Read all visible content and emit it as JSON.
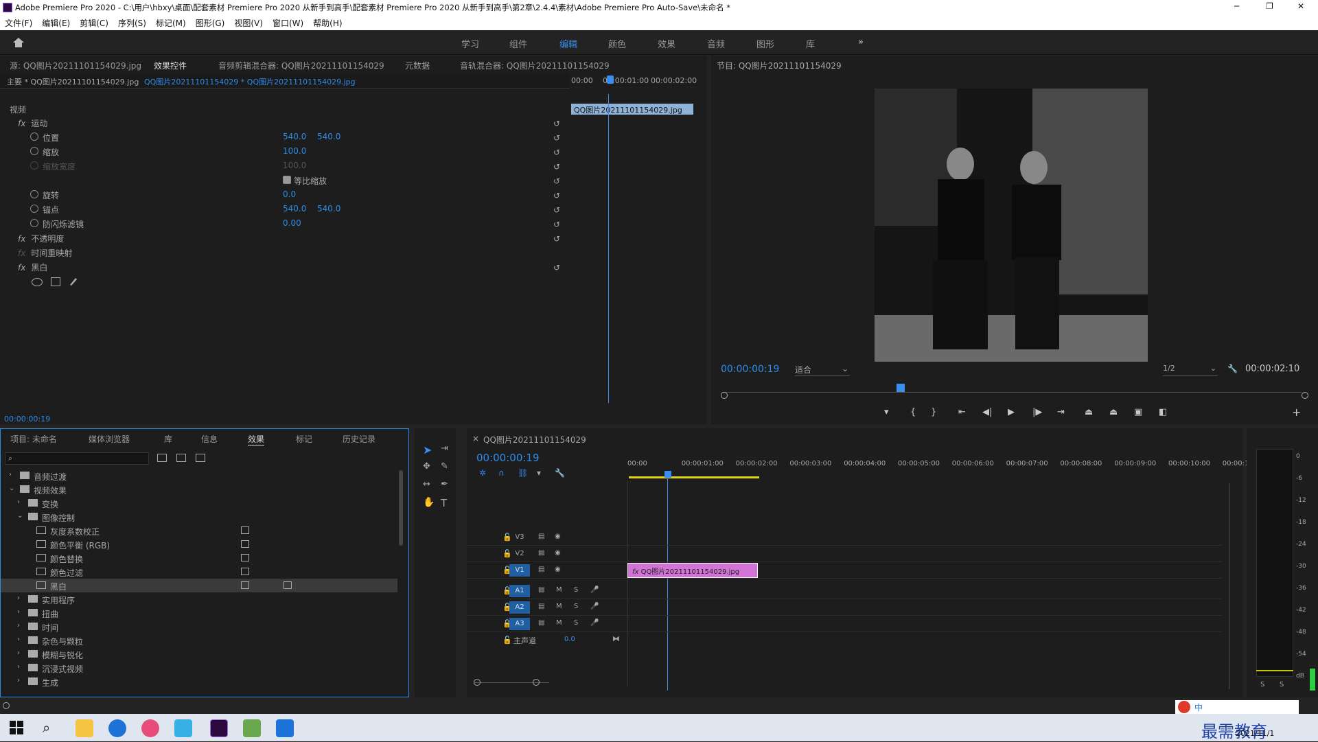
{
  "title": "Adobe Premiere Pro 2020 - C:\\用户\\hbxy\\桌面\\配套素材 Premiere Pro 2020 从新手到高手\\配套素材 Premiere Pro 2020 从新手到高手\\第2章\\2.4.4\\素材\\Adobe Premiere Pro Auto-Save\\未命名 *",
  "window_controls": {
    "min": "─",
    "max": "❐",
    "close": "✕"
  },
  "menu": [
    "文件(F)",
    "编辑(E)",
    "剪辑(C)",
    "序列(S)",
    "标记(M)",
    "图形(G)",
    "视图(V)",
    "窗口(W)",
    "帮助(H)"
  ],
  "workspaces": [
    "学习",
    "组件",
    "编辑",
    "颜色",
    "效果",
    "音频",
    "图形",
    "库"
  ],
  "ws_more": "»",
  "source_tabs": [
    "源: QQ图片20211101154029.jpg",
    "效果控件",
    "音频剪辑混合器: QQ图片20211101154029",
    "元数据",
    "音轨混合器: QQ图片20211101154029"
  ],
  "ec": {
    "master": "主要 * QQ图片20211101154029.jpg",
    "clip": "QQ图片20211101154029 * QQ图片20211101154029.jpg",
    "ruler": [
      "00:00",
      "00:00:01:00",
      "00:00:02:00"
    ],
    "clip_bar": "QQ图片20211101154029.jpg",
    "video": "视频",
    "motion": "运动",
    "position": "位置",
    "pos_x": "540.0",
    "pos_y": "540.0",
    "scale": "缩放",
    "scale_v": "100.0",
    "scale_w": "缩放宽度",
    "scale_w_v": "100.0",
    "uniform": "等比缩放",
    "rotation": "旋转",
    "rot_v": "0.0",
    "anchor": "锚点",
    "anc_x": "540.0",
    "anc_y": "540.0",
    "flicker": "防闪烁滤镜",
    "flicker_v": "0.00",
    "opacity": "不透明度",
    "timeremap": "时间重映射",
    "bw": "黑白",
    "fx": "fx",
    "time": "00:00:00:19"
  },
  "program": {
    "title": "节目: QQ图片20211101154029",
    "time": "00:00:00:19",
    "fit": "适合",
    "res": "1/2",
    "duration": "00:00:02:10"
  },
  "project_tabs": [
    "项目: 未命名",
    "媒体浏览器",
    "库",
    "信息",
    "效果",
    "标记",
    "历史记录"
  ],
  "effects": [
    {
      "t": "音频过渡",
      "lv": 0,
      "open": false
    },
    {
      "t": "视频效果",
      "lv": 0,
      "open": true
    },
    {
      "t": "变换",
      "lv": 1,
      "open": false
    },
    {
      "t": "图像控制",
      "lv": 1,
      "open": true
    },
    {
      "t": "灰度系数校正",
      "lv": 2,
      "leaf": true
    },
    {
      "t": "颜色平衡 (RGB)",
      "lv": 2,
      "leaf": true
    },
    {
      "t": "颜色替换",
      "lv": 2,
      "leaf": true
    },
    {
      "t": "颜色过滤",
      "lv": 2,
      "leaf": true
    },
    {
      "t": "黑白",
      "lv": 2,
      "leaf": true,
      "sel": true
    },
    {
      "t": "实用程序",
      "lv": 1
    },
    {
      "t": "扭曲",
      "lv": 1
    },
    {
      "t": "时间",
      "lv": 1
    },
    {
      "t": "杂色与颗粒",
      "lv": 1
    },
    {
      "t": "模糊与锐化",
      "lv": 1
    },
    {
      "t": "沉浸式视频",
      "lv": 1
    },
    {
      "t": "生成",
      "lv": 1
    }
  ],
  "timeline": {
    "name": "QQ图片20211101154029",
    "time": "00:00:00:19",
    "ruler": [
      "00:00",
      "00:00:01:00",
      "00:00:02:00",
      "00:00:03:00",
      "00:00:04:00",
      "00:00:05:00",
      "00:00:06:00",
      "00:00:07:00",
      "00:00:08:00",
      "00:00:09:00",
      "00:00:10:00",
      "00:00:1"
    ],
    "tracks": [
      "V3",
      "V2",
      "V1",
      "A1",
      "A2",
      "A3"
    ],
    "master": "主声道",
    "master_v": "0.0",
    "clip": "QQ图片20211101154029.jpg",
    "fx": "fx"
  },
  "meter": {
    "ticks": [
      "0",
      "-6",
      "-12",
      "-18",
      "-24",
      "-30",
      "-36",
      "-42",
      "-48",
      "-54",
      "dB"
    ],
    "s": "S"
  },
  "tray": {
    "ime": "中",
    "brand": "最需教育",
    "date": "2021/11/1"
  }
}
